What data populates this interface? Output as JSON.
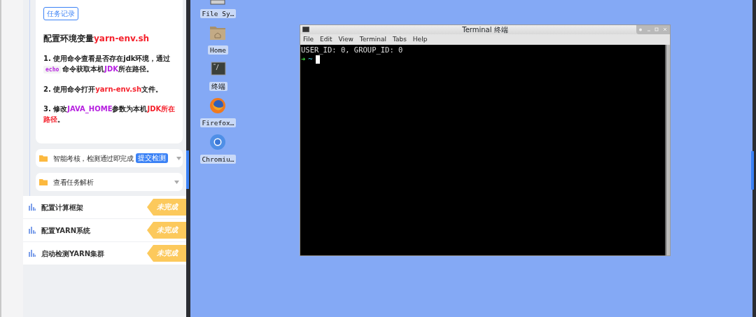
{
  "sidebar": {
    "card": {
      "tag": "任务记录",
      "title": [
        {
          "kind": "plain",
          "text": "配置环境变量"
        },
        {
          "kind": "path",
          "text": "yarn-env.sh"
        }
      ],
      "steps": [
        [
          {
            "kind": "plain",
            "text": "1. 使用命令查看是否存在jdk环境，通过"
          },
          {
            "kind": "code",
            "text": "echo"
          },
          {
            "kind": "plain",
            "text": "命令获取本机"
          },
          {
            "kind": "term",
            "text": "JDK"
          },
          {
            "kind": "plain",
            "text": "所在路径。"
          }
        ],
        [
          {
            "kind": "plain",
            "text": "2. 使用命令打开"
          },
          {
            "kind": "path",
            "text": "yarn-env.sh"
          },
          {
            "kind": "plain",
            "text": "文件。"
          }
        ],
        [
          {
            "kind": "plain",
            "text": "3. 修改"
          },
          {
            "kind": "term",
            "text": "JAVA_HOME"
          },
          {
            "kind": "plain",
            "text": "参数为本机"
          },
          {
            "kind": "path",
            "text": "JDK所在路径"
          },
          {
            "kind": "plain",
            "text": "。"
          }
        ]
      ]
    },
    "sections": [
      {
        "label": "智能考核，检测通过即完成",
        "button": "提交检测"
      },
      {
        "label": "查看任务解析"
      }
    ],
    "tasks": [
      {
        "label": "配置计算框架",
        "status": "未完成"
      },
      {
        "label": "配置YARN系统",
        "status": "未完成"
      },
      {
        "label": "启动检测YARN集群",
        "status": "未完成"
      }
    ]
  },
  "desktop": {
    "icons": [
      {
        "kind": "drive",
        "label": "File Sy…"
      },
      {
        "kind": "home",
        "label": "Home"
      },
      {
        "kind": "terminal",
        "label": "终端"
      },
      {
        "kind": "firefox",
        "label": "Firefox…"
      },
      {
        "kind": "chromium",
        "label": "Chromiu…"
      }
    ]
  },
  "terminal": {
    "title": "Terminal 终端",
    "menu": [
      "File",
      "Edit",
      "View",
      "Terminal",
      "Tabs",
      "Help"
    ],
    "lines": [
      "USER_ID: 0, GROUP_ID: 0"
    ],
    "prompt": {
      "arrow": "➜",
      "path": "~"
    }
  }
}
